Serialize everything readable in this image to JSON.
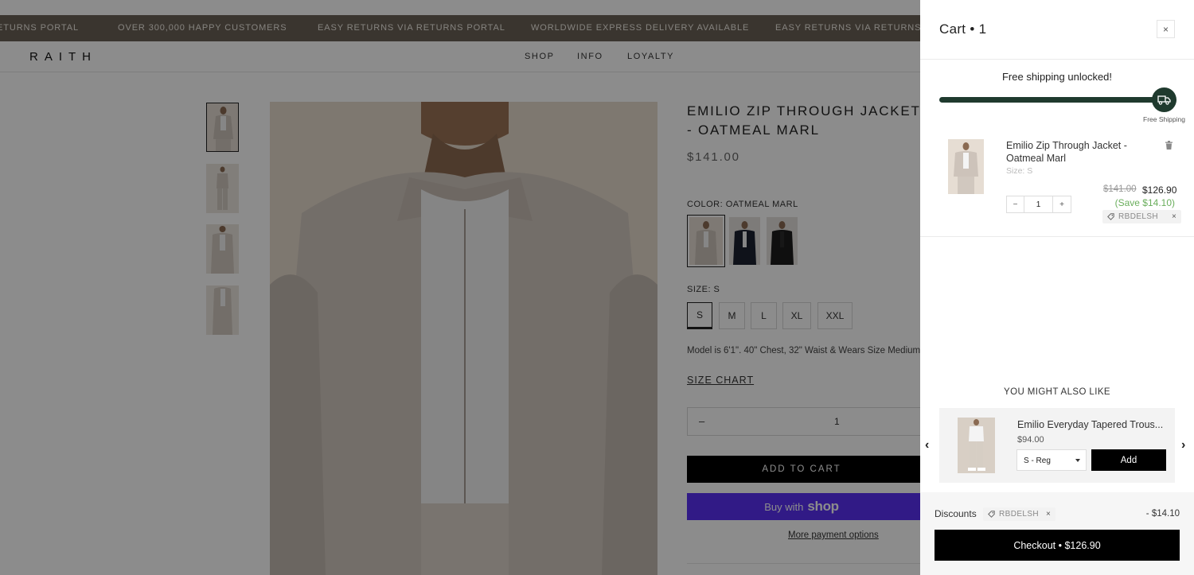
{
  "announcement": {
    "items": [
      "ETURNS PORTAL",
      "OVER 300,000 HAPPY CUSTOMERS",
      "EASY RETURNS VIA RETURNS PORTAL",
      "WORLDWIDE EXPRESS DELIVERY AVAILABLE",
      "EASY RETURNS VIA RETURNS POR"
    ],
    "bg": "#6b6156"
  },
  "header": {
    "logo": "RAITH",
    "nav": [
      "SHOP",
      "INFO",
      "LOYALTY"
    ]
  },
  "product": {
    "title": "EMILIO ZIP THROUGH JACKET - OATMEAL MARL",
    "price": "$141.00",
    "color_label": "COLOR: OATMEAL MARL",
    "size_label": "SIZE: S",
    "sizes": [
      "S",
      "M",
      "L",
      "XL",
      "XXL"
    ],
    "selected_size": "S",
    "model_info": "Model is 6'1\". 40\" Chest, 32\" Waist & Wears Size Medium",
    "size_chart": "SIZE CHART",
    "qty_minus": "–",
    "qty_value": "1",
    "add_to_cart": "ADD TO CART",
    "buy_with": "Buy with",
    "shop": "shop",
    "more_payment": "More payment options"
  },
  "cart": {
    "title": "Cart • 1",
    "close": "×",
    "free_shipping_text": "Free shipping unlocked!",
    "free_shipping_label": "Free Shipping",
    "free_shipping_progress": 1.0,
    "item": {
      "name": "Emilio Zip Through Jacket - Oatmeal Marl",
      "size": "Size: S",
      "qty": "1",
      "minus": "−",
      "plus": "+",
      "old_price": "$141.00",
      "new_price": "$126.90",
      "save": "(Save $14.10)",
      "code": "RBDELSH",
      "code_remove": "×"
    },
    "recommend": {
      "heading": "YOU MIGHT ALSO LIKE",
      "name": "Emilio Everyday Tapered Trous...",
      "price": "$94.00",
      "variant": "S - Reg",
      "add": "Add",
      "prev": "‹",
      "next": "›"
    },
    "discounts_label": "Discounts",
    "discount_code": "RBDELSH",
    "discount_remove": "×",
    "discount_amount": "- $14.10",
    "checkout": "Checkout • $126.90",
    "accent": "#1f3a2e"
  }
}
